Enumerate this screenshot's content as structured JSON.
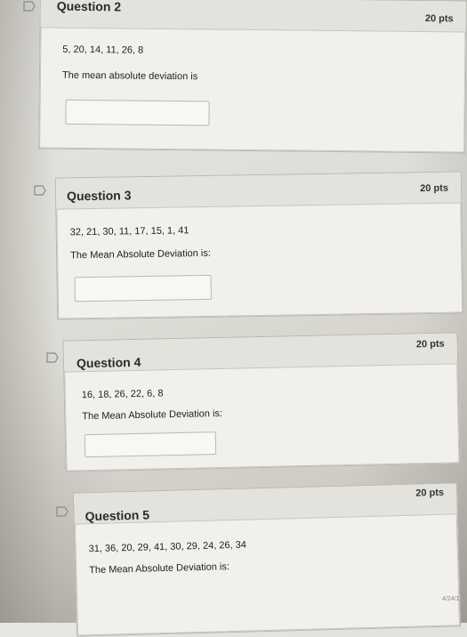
{
  "questions": [
    {
      "title": "Question 2",
      "points": "20 pts",
      "numbers": "5, 20, 14, 11, 26, 8",
      "prompt": "The mean absolute deviation is"
    },
    {
      "title": "Question 3",
      "points": "20 pts",
      "numbers": "32, 21, 30, 11, 17, 15, 1, 41",
      "prompt": "The Mean Absolute Deviation is:"
    },
    {
      "title": "Question 4",
      "points": "20 pts",
      "numbers": "16, 18, 26, 22, 6, 8",
      "prompt": "The Mean Absolute Deviation is:"
    },
    {
      "title": "Question 5",
      "points": "20 pts",
      "numbers": "31, 36, 20, 29, 41, 30, 29, 24, 26, 34",
      "prompt": "The Mean Absolute Deviation is:"
    }
  ],
  "footer": {
    "date": "4/24/1"
  },
  "icons": {
    "flag": "flag-icon"
  }
}
